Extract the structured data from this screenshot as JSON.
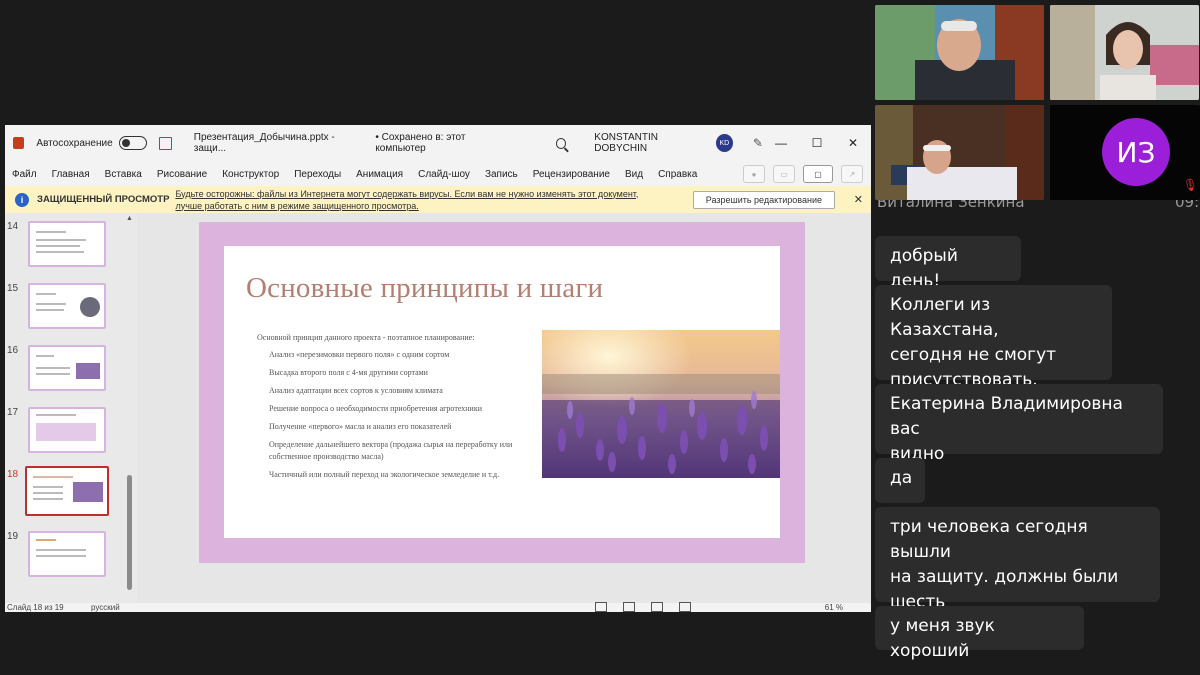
{
  "ppt": {
    "autosave_label": "Автосохранение",
    "doc_title": "Презентация_Добычина.pptx  -  защи...",
    "saved_status": "• Сохранено в: этот компьютер",
    "user_name": "KONSTANTIN DOBYCHIN",
    "user_initials": "KD",
    "window_buttons": {
      "minimize": "—",
      "maximize": "☐",
      "close": "✕"
    },
    "menu": [
      "Файл",
      "Главная",
      "Вставка",
      "Рисование",
      "Конструктор",
      "Переходы",
      "Анимация",
      "Слайд-шоу",
      "Запись",
      "Рецензирование",
      "Вид",
      "Справка"
    ],
    "protected_view": {
      "title": "ЗАЩИЩЕННЫЙ ПРОСМОТР",
      "message_line1": "Будьте осторожны: файлы из Интернета могут содержать вирусы. Если вам не нужно изменять этот документ,",
      "message_line2": "лучше работать с ним в режиме защищенного просмотра.",
      "enable_button": "Разрешить редактирование",
      "close": "✕"
    },
    "thumbnails": [
      {
        "num": "14",
        "selected": false
      },
      {
        "num": "15",
        "selected": false
      },
      {
        "num": "16",
        "selected": false
      },
      {
        "num": "17",
        "selected": false
      },
      {
        "num": "18",
        "selected": true
      },
      {
        "num": "19",
        "selected": false
      }
    ],
    "slide": {
      "title": "Основные принципы и шаги",
      "intro": "Основной принцип данного проекта - поэтапное планирование:",
      "items": [
        "Анализ «перезимовки первого поля» с одним сортом",
        "Высадка второго поля  с 4-мя другими сортами",
        "Анализ адаптации всех сортов к условиям климата",
        "Решение вопроса о необходимости приобретения агротехники",
        "Получение «первого» масла и анализ его показателей",
        "Определение дальнейшего вектора (продажа сырья на переработку или собственное производство масла)",
        "Частичный или полный переход на экологическое земледелие и т.д."
      ]
    },
    "status": {
      "slide_counter": "Слайд 18 из 19",
      "language": "русский",
      "zoom": "61 %"
    }
  },
  "video": {
    "avatar_initials": "ИЗ",
    "participant_name": "Виталина Зенкина",
    "participant_time": "09:"
  },
  "chat": {
    "messages": [
      {
        "lines": [
          "добрый день!"
        ]
      },
      {
        "lines": [
          "Коллеги из Казахстана,",
          "сегодня не смогут",
          "присутствовать."
        ]
      },
      {
        "lines": [
          "Екатерина Владимировна вас",
          "видно"
        ]
      },
      {
        "lines": [
          "да"
        ]
      },
      {
        "lines": [
          "три человека сегодня вышли",
          "на защиту. должны были",
          "шесть"
        ]
      },
      {
        "lines": [
          "у меня звук хороший"
        ]
      }
    ]
  },
  "colors": {
    "slide_border": "#dcb3dc",
    "slide_title": "#b37f73",
    "avatar_bg": "#9b1ed8",
    "protected_bg": "#fcf2c2",
    "selected_thumb": "#b5332a"
  }
}
